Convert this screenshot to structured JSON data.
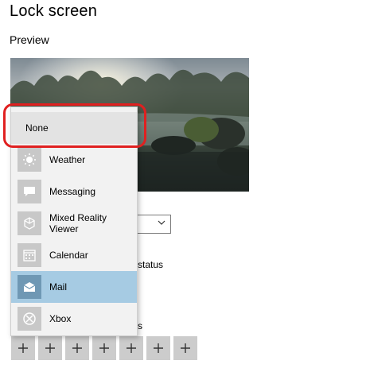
{
  "page": {
    "title": "Lock screen"
  },
  "preview": {
    "label": "Preview"
  },
  "background_fragments": {
    "status_suffix": "status",
    "s_suffix": "s"
  },
  "dropdown": {
    "items": [
      {
        "label": "None",
        "icon": ""
      },
      {
        "label": "Weather",
        "icon": "weather-icon"
      },
      {
        "label": "Messaging",
        "icon": "messaging-icon"
      },
      {
        "label": "Mixed Reality Viewer",
        "icon": "mixed-reality-icon"
      },
      {
        "label": "Calendar",
        "icon": "calendar-icon"
      },
      {
        "label": "Mail",
        "icon": "mail-icon",
        "selected": true
      },
      {
        "label": "Xbox",
        "icon": "xbox-icon"
      }
    ]
  },
  "quick_status_slots": {
    "count_label": "+",
    "icon": "plus-icon"
  },
  "colors": {
    "highlight_border": "#e02020",
    "selected_item_bg": "#a6cbe3",
    "slot_bg": "#cccccc"
  }
}
